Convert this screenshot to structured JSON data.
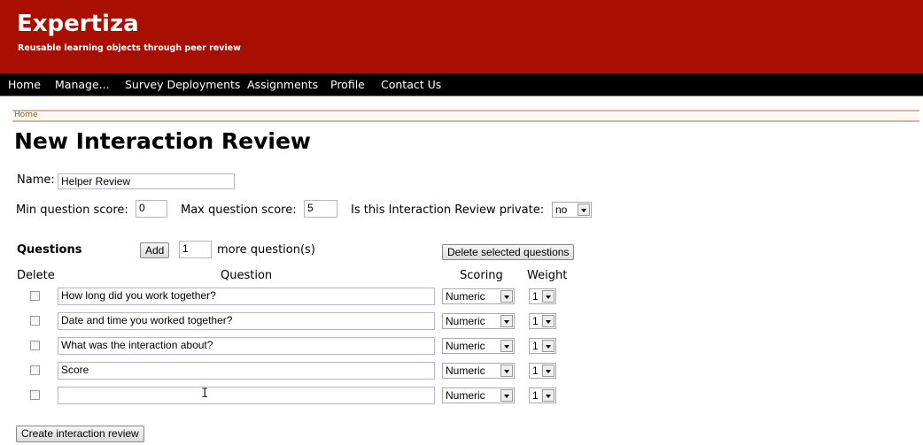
{
  "header": {
    "title": "Expertiza",
    "tagline": "Reusable learning objects through peer review"
  },
  "nav": [
    "Home",
    "Manage...",
    "Survey Deployments",
    "Assignments",
    "Profile",
    "Contact Us"
  ],
  "breadcrumb": "Home",
  "page_title": "New Interaction Review",
  "form": {
    "name_label": "Name:",
    "name_value": "Helper Review",
    "min_label": "Min question score:",
    "min_value": "0",
    "max_label": "Max question score:",
    "max_value": "5",
    "private_label": "Is this Interaction Review private:",
    "private_value": "no"
  },
  "questions": {
    "heading": "Questions",
    "add_label": "Add",
    "add_count": "1",
    "more_label": "more question(s)",
    "delete_selected_label": "Delete selected questions",
    "columns": {
      "delete": "Delete",
      "question": "Question",
      "scoring": "Scoring",
      "weight": "Weight"
    },
    "rows": [
      {
        "text": "How long did you work together?",
        "scoring": "Numeric",
        "weight": "1"
      },
      {
        "text": "Date and time you worked together?",
        "scoring": "Numeric",
        "weight": "1"
      },
      {
        "text": "What was the interaction about?",
        "scoring": "Numeric",
        "weight": "1"
      },
      {
        "text": "Score",
        "scoring": "Numeric",
        "weight": "1"
      },
      {
        "text": "",
        "scoring": "Numeric",
        "weight": "1"
      }
    ]
  },
  "submit_label": "Create interaction review",
  "cursor": "I"
}
